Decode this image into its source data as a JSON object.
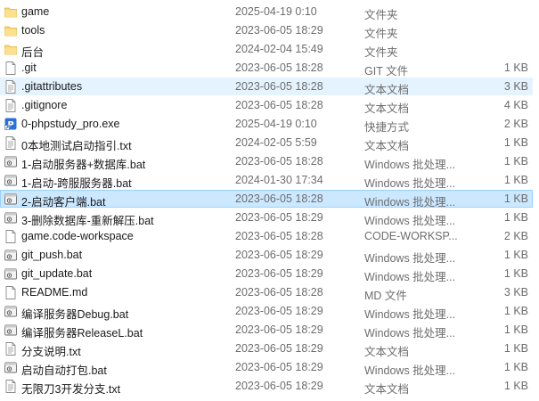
{
  "files": [
    {
      "name": "game",
      "date": "2025-04-19 0:10",
      "type": "文件夹",
      "size": "",
      "icon": "folder-icon"
    },
    {
      "name": "tools",
      "date": "2023-06-05 18:29",
      "type": "文件夹",
      "size": "",
      "icon": "folder-icon"
    },
    {
      "name": "后台",
      "date": "2024-02-04 15:49",
      "type": "文件夹",
      "size": "",
      "icon": "folder-icon"
    },
    {
      "name": ".git",
      "date": "2023-06-05 18:28",
      "type": "GIT 文件",
      "size": "1 KB",
      "icon": "blank-file-icon"
    },
    {
      "name": ".gitattributes",
      "date": "2023-06-05 18:28",
      "type": "文本文档",
      "size": "3 KB",
      "icon": "text-file-icon",
      "state": "hover"
    },
    {
      "name": ".gitignore",
      "date": "2023-06-05 18:28",
      "type": "文本文档",
      "size": "4 KB",
      "icon": "text-file-icon"
    },
    {
      "name": "0-phpstudy_pro.exe",
      "date": "2025-04-19 0:10",
      "type": "快捷方式",
      "size": "2 KB",
      "icon": "shortcut-app-icon"
    },
    {
      "name": "0本地测试启动指引.txt",
      "date": "2024-02-05 5:59",
      "type": "文本文档",
      "size": "1 KB",
      "icon": "text-file-icon"
    },
    {
      "name": "1-启动服务器+数据库.bat",
      "date": "2023-06-05 18:28",
      "type": "Windows 批处理...",
      "size": "1 KB",
      "icon": "batch-file-icon"
    },
    {
      "name": "1-启动-跨服服务器.bat",
      "date": "2024-01-30 17:34",
      "type": "Windows 批处理...",
      "size": "1 KB",
      "icon": "batch-file-icon"
    },
    {
      "name": "2-启动客户端.bat",
      "date": "2023-06-05 18:28",
      "type": "Windows 批处理...",
      "size": "1 KB",
      "icon": "batch-file-icon",
      "state": "selected"
    },
    {
      "name": "3-删除数据库-重新解压.bat",
      "date": "2023-06-05 18:29",
      "type": "Windows 批处理...",
      "size": "1 KB",
      "icon": "batch-file-icon"
    },
    {
      "name": "game.code-workspace",
      "date": "2023-06-05 18:28",
      "type": "CODE-WORKSP...",
      "size": "2 KB",
      "icon": "blank-file-icon"
    },
    {
      "name": "git_push.bat",
      "date": "2023-06-05 18:29",
      "type": "Windows 批处理...",
      "size": "1 KB",
      "icon": "batch-file-icon"
    },
    {
      "name": "git_update.bat",
      "date": "2023-06-05 18:29",
      "type": "Windows 批处理...",
      "size": "1 KB",
      "icon": "batch-file-icon"
    },
    {
      "name": "README.md",
      "date": "2023-06-05 18:28",
      "type": "MD 文件",
      "size": "3 KB",
      "icon": "blank-file-icon"
    },
    {
      "name": "编译服务器Debug.bat",
      "date": "2023-06-05 18:29",
      "type": "Windows 批处理...",
      "size": "1 KB",
      "icon": "batch-file-icon"
    },
    {
      "name": "编译服务器ReleaseL.bat",
      "date": "2023-06-05 18:29",
      "type": "Windows 批处理...",
      "size": "1 KB",
      "icon": "batch-file-icon"
    },
    {
      "name": "分支说明.txt",
      "date": "2023-06-05 18:29",
      "type": "文本文档",
      "size": "1 KB",
      "icon": "text-file-icon"
    },
    {
      "name": "启动自动打包.bat",
      "date": "2023-06-05 18:29",
      "type": "Windows 批处理...",
      "size": "1 KB",
      "icon": "batch-file-icon"
    },
    {
      "name": "无限刀3开发分支.txt",
      "date": "2023-06-05 18:29",
      "type": "文本文档",
      "size": "1 KB",
      "icon": "text-file-icon"
    }
  ],
  "colors": {
    "folder": "#f8d775",
    "hover": "#e5f3ff",
    "selected": "#cce8ff",
    "selected_border": "#99d1ff"
  }
}
